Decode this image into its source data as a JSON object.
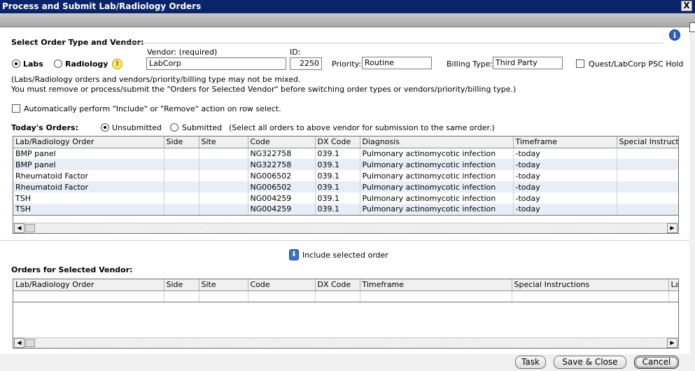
{
  "window": {
    "title": "Process and Submit Lab/Radiology Orders",
    "close_glyph": "X"
  },
  "section_order_type": {
    "title": "Select Order Type and Vendor:",
    "radio_labs": "Labs",
    "radio_radiology": "Radiology",
    "selected": "Labs"
  },
  "vendor": {
    "label": "Vendor:  (required)",
    "value": "LabCorp"
  },
  "id_field": {
    "label": "ID:",
    "value": "2250"
  },
  "priority": {
    "label": "Priority:",
    "value": "Routine"
  },
  "billing": {
    "label": "Billing Type:",
    "value": "Third Party"
  },
  "psc_hold": {
    "label": "Quest/LabCorp PSC Hold",
    "checked": false
  },
  "notice": {
    "line1": "(Labs/Radiology orders and vendors/priority/billing type may not be mixed.",
    "line2": "You must remove or process/submit the \"Orders for Selected Vendor\" before switching order types or vendors/priority/billing type.)"
  },
  "auto_action": {
    "label": "Automatically perform \"Include\" or \"Remove\" action on row select.",
    "checked": false
  },
  "todays_orders": {
    "title": "Today's Orders:",
    "radio_unsubmitted": "Unsubmitted",
    "radio_submitted": "Submitted",
    "selected": "Unsubmitted",
    "hint": "(Select all orders to above vendor for submission to the same order.)",
    "columns": [
      "Lab/Radiology Order",
      "Side",
      "Site",
      "Code",
      "DX Code",
      "Diagnosis",
      "Timeframe",
      "Special Instructio"
    ],
    "rows": [
      [
        "BMP panel",
        "",
        "",
        "NG322758",
        "039.1",
        "Pulmonary actinomycotic infection",
        "-today",
        ""
      ],
      [
        "BMP panel",
        "",
        "",
        "NG322758",
        "039.1",
        "Pulmonary actinomycotic infection",
        "-today",
        ""
      ],
      [
        "Rheumatoid Factor",
        "",
        "",
        "NG006502",
        "039.1",
        "Pulmonary actinomycotic infection",
        "-today",
        ""
      ],
      [
        "Rheumatoid Factor",
        "",
        "",
        "NG006502",
        "039.1",
        "Pulmonary actinomycotic infection",
        "-today",
        ""
      ],
      [
        "TSH",
        "",
        "",
        "NG004259",
        "039.1",
        "Pulmonary actinomycotic infection",
        "-today",
        ""
      ],
      [
        "TSH",
        "",
        "",
        "NG004259",
        "039.1",
        "Pulmonary actinomycotic infection",
        "-today",
        ""
      ]
    ]
  },
  "include_button": {
    "label": "Include selected order"
  },
  "vendor_orders": {
    "title": "Orders for Selected Vendor:",
    "columns": [
      "Lab/Radiology Order",
      "Side",
      "Site",
      "Code",
      "DX Code",
      "Timeframe",
      "Special Instructions",
      "La"
    ]
  },
  "scroll": {
    "left_glyph": "◀",
    "right_glyph": "▶"
  },
  "footer": {
    "task": "Task",
    "save_close": "Save & Close",
    "cancel": "Cancel"
  },
  "icons": {
    "info": "info-icon",
    "warning": "warning-icon",
    "include": "down-arrow-icon"
  }
}
